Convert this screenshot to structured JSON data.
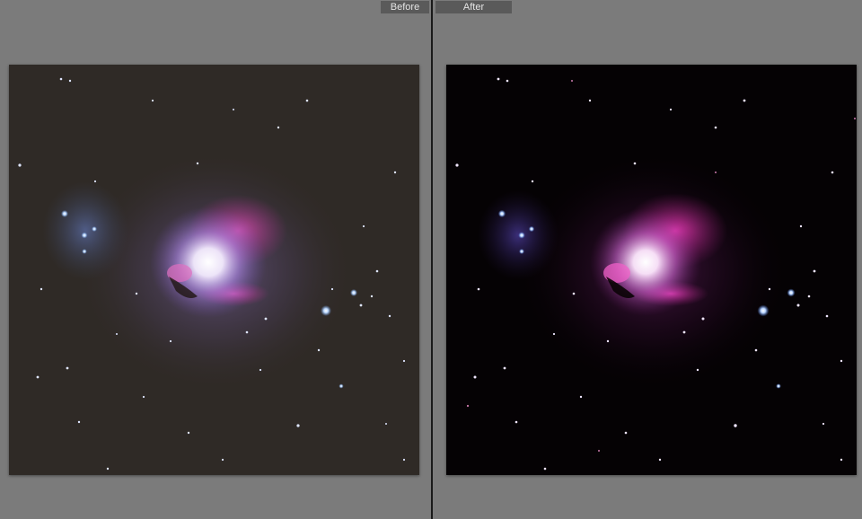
{
  "compare_view": {
    "before_label": "Before",
    "after_label": "After"
  },
  "photos": {
    "before": {
      "subject": "orion-nebula-unedited",
      "background_color": "#2f2a26"
    },
    "after": {
      "subject": "orion-nebula-edited",
      "background_color": "#050204"
    }
  },
  "colors": {
    "workspace": "#7b7b7b",
    "label_bg": "#5a5a5a",
    "label_text": "#e4e4e4",
    "divider": "#1a1a1a",
    "nebula_magenta": "#c23c9a",
    "nebula_core": "#ffffff",
    "star_blue": "#9cc6ff"
  }
}
